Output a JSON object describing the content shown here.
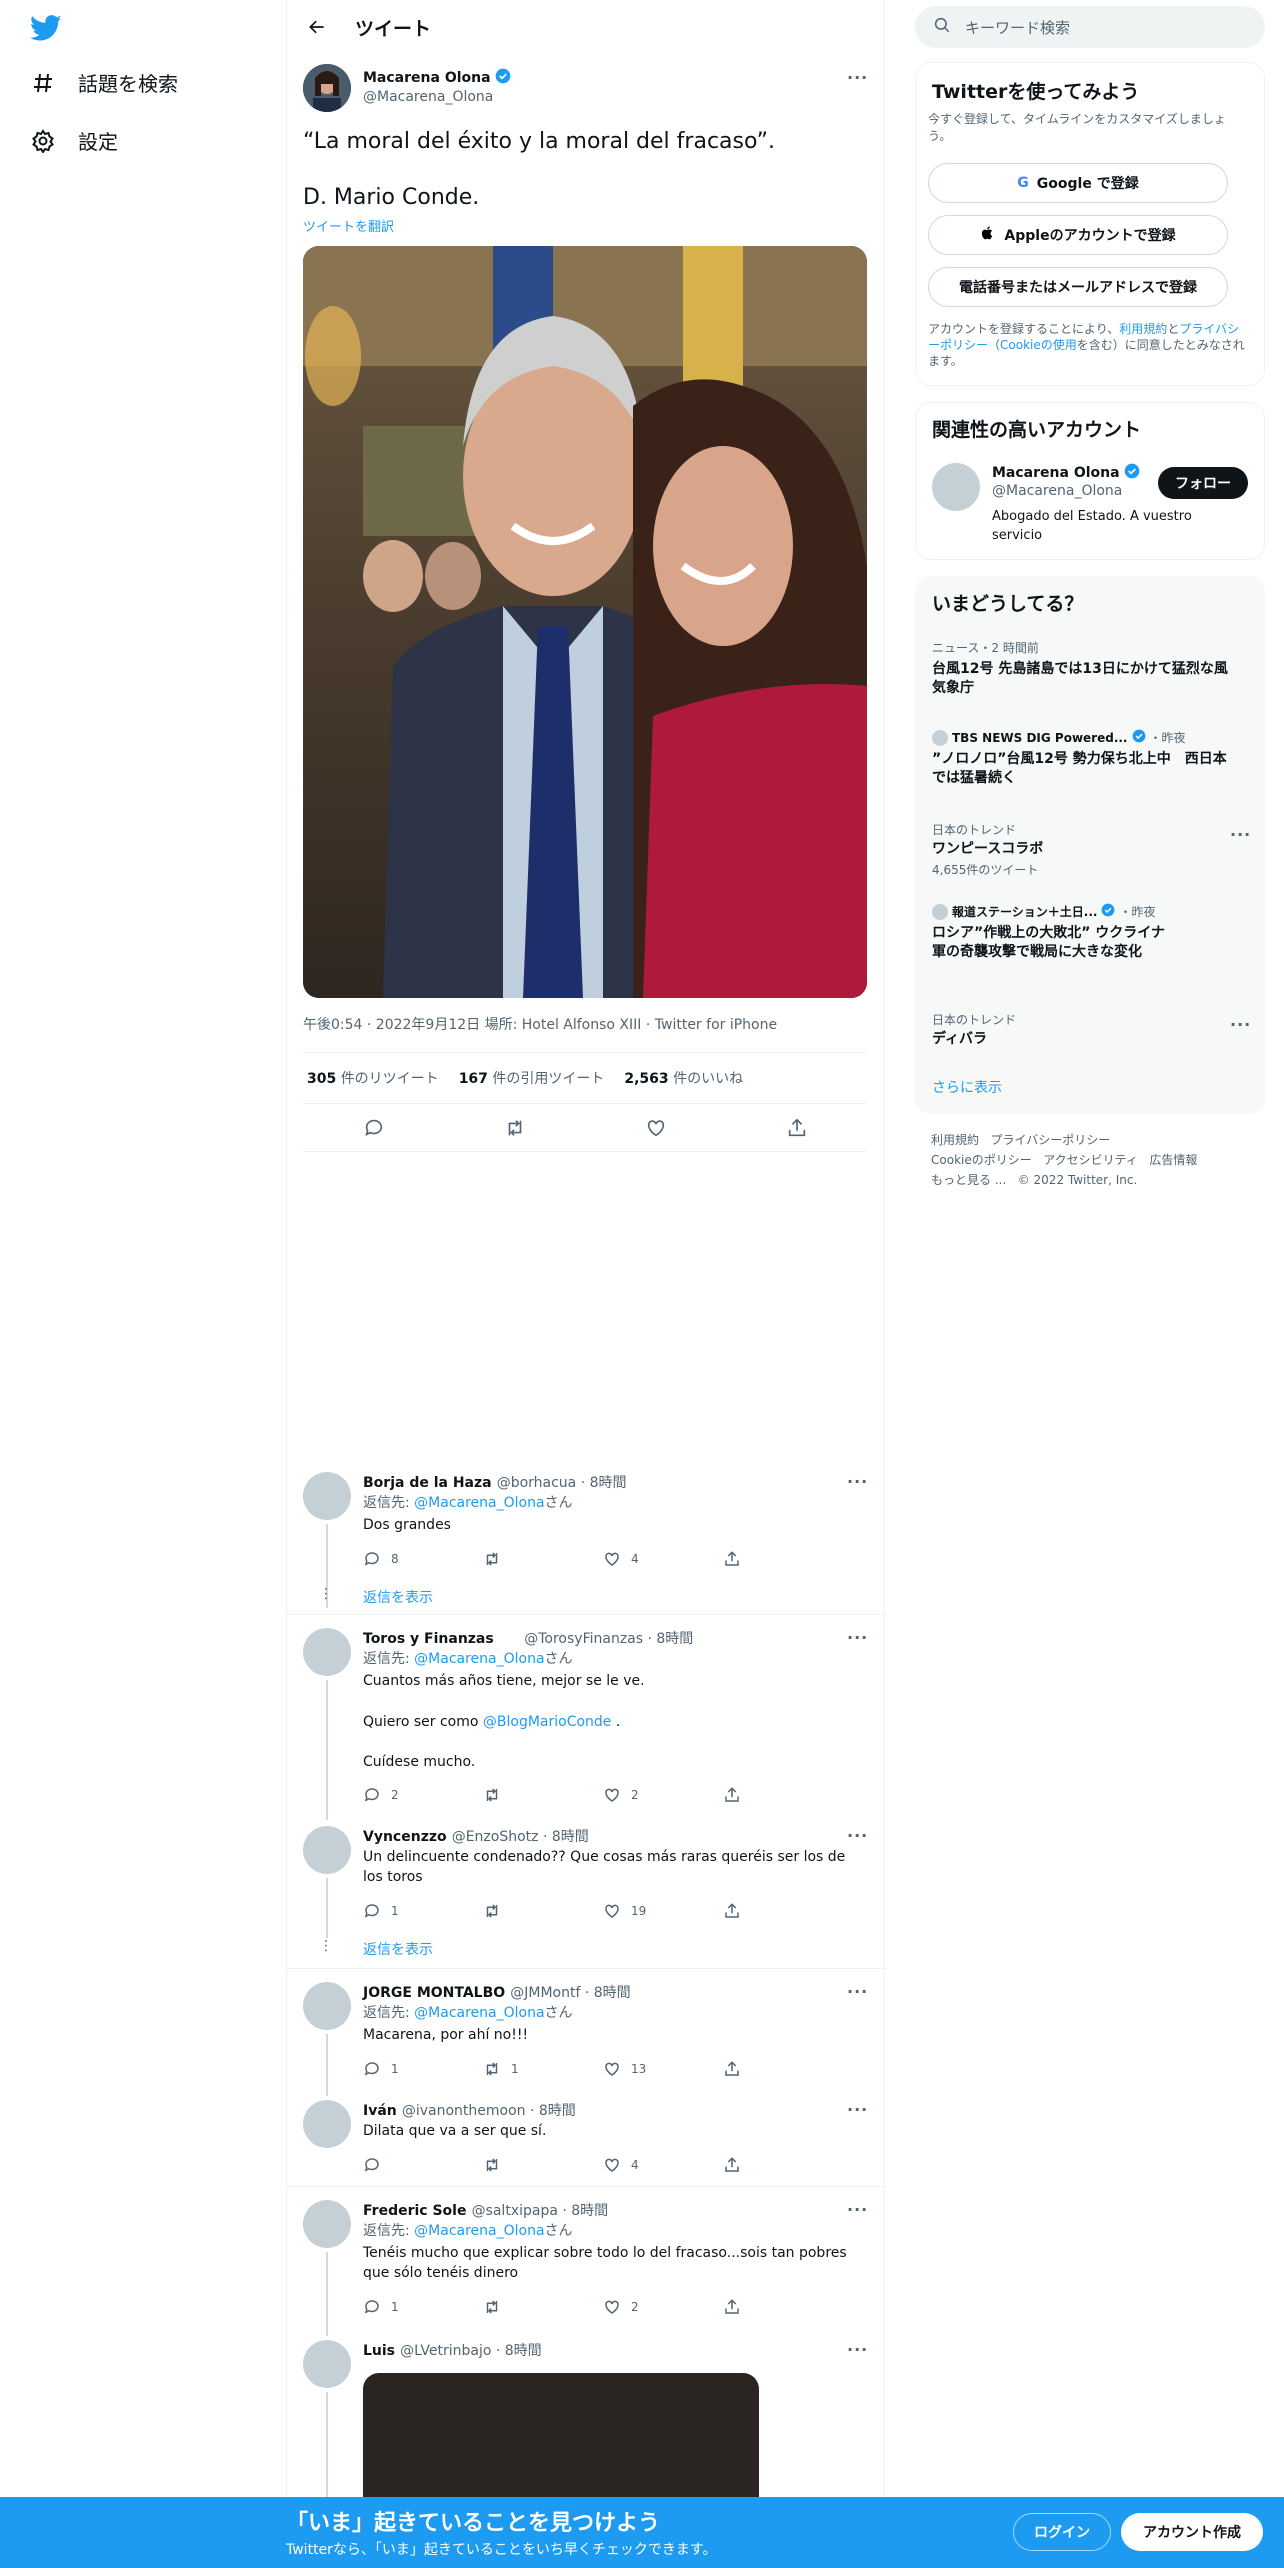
{
  "nav": {
    "explore": "話題を検索",
    "settings": "設定"
  },
  "header": {
    "title": "ツイート"
  },
  "tweet": {
    "name": "Macarena Olona",
    "handle": "@Macarena_Olona",
    "line1": "“La moral del éxito y la moral del fracaso”.",
    "line2": "D. Mario Conde.",
    "translate": "ツイートを翻訳",
    "meta": "午後0:54 · 2022年9月12日 場所: Hotel Alfonso XIII · Twitter for iPhone",
    "retweets_num": "305",
    "retweets_label": "件のリツイート",
    "quotes_num": "167",
    "quotes_label": "件の引用ツイート",
    "likes_num": "2,563",
    "likes_label": "件のいいね"
  },
  "reply_to_prefix": "返信先: ",
  "reply_to_handle": "@Macarena_Olona",
  "reply_to_suffix": "さん",
  "show_replies": "返信を表示",
  "replies": [
    {
      "name": "Borja de la Haza",
      "handle": "@borhacua · 8時間",
      "text": "Dos grandes",
      "replies": "8",
      "rts": "",
      "likes": "4"
    },
    {
      "name": "Toros y Finanzas",
      "handle": "@TorosyFinanzas · 8時間",
      "text1": "Cuantos más años tiene, mejor se le ve.",
      "text2a": "Quiero ser como ",
      "text2b": "@BlogMarioConde",
      "text2c": " .",
      "text3": "Cuídese mucho.",
      "replies": "2",
      "rts": "",
      "likes": "2"
    },
    {
      "name": "Vyncenzzo",
      "handle": "@EnzoShotz · 8時間",
      "text": "Un delincuente condenado?? Que cosas más raras queréis ser los de los toros",
      "replies": "1",
      "rts": "",
      "likes": "19"
    },
    {
      "name": "JORGE MONTALBO",
      "handle": "@JMMontf · 8時間",
      "text": "Macarena, por ahí no!!!",
      "replies": "1",
      "rts": "1",
      "likes": "13"
    },
    {
      "name": "Iván",
      "handle": "@ivanonthemoon · 8時間",
      "text": "Dilata que va a ser que sí.",
      "replies": "",
      "rts": "",
      "likes": "4"
    },
    {
      "name": "Frederic Sole",
      "handle": "@saltxipapa · 8時間",
      "text": "Tenéis mucho que explicar sobre todo lo del fracaso...sois tan pobres que sólo tenéis dinero",
      "replies": "1",
      "rts": "",
      "likes": "2"
    },
    {
      "name": "Luis",
      "handle": "@LVetrinbajo · 8時間"
    }
  ],
  "right": {
    "search_placeholder": "キーワード検索",
    "signup": {
      "title": "Twitterを使ってみよう",
      "subtitle": "今すぐ登録して、タイムラインをカスタマイズしましょう。",
      "google": "Google で登録",
      "apple": "Appleのアカウントで登録",
      "phone": "電話番号またはメールアドレスで登録",
      "terms_a": "アカウントを登録することにより、",
      "terms_b": "利用規約",
      "terms_c": "と",
      "terms_d": "プライバシーポリシー",
      "terms_e": "（",
      "terms_f": "Cookieの使用",
      "terms_g": "を含む）に同意したとみなされます。"
    },
    "related": {
      "title": "関連性の高いアカウント",
      "name": "Macarena Olona",
      "handle": "@Macarena_Olona",
      "bio": "Abogado del Estado. A vuestro servicio",
      "follow": "フォロー"
    },
    "trends": {
      "title": "いまどうしてる？",
      "items": [
        {
          "cat": "ニュース・2 時間前",
          "title": "台風12号 先島諸島では13日にかけて猛烈な風 気象庁"
        },
        {
          "cat": "TBS NEWS DIG Powered...",
          "cat2": "・昨夜",
          "title": "”ノロノロ”台風12号 勢力保ち北上中　西日本では猛暑続く"
        },
        {
          "cat": "日本のトレンド",
          "title": "ワンピースコラボ",
          "sub": "4,655件のツイート"
        },
        {
          "cat": "報道ステーション＋土日...",
          "cat2": "・昨夜",
          "title": "ロシア”作戦上の大敗北” ウクライナ軍の奇襲攻撃で戦局に大きな変化"
        },
        {
          "cat": "日本のトレンド",
          "title": "ディバラ"
        }
      ],
      "more": "さらに表示"
    },
    "footer": {
      "l1a": "利用規約",
      "l1b": "プライバシーポリシー",
      "l2a": "Cookieのポリシー",
      "l2b": "アクセシビリティ",
      "l2c": "広告情報",
      "l3a": "もっと見る ...",
      "l3b": "© 2022 Twitter, Inc."
    }
  },
  "bottom": {
    "title": "「いま」起きていることを見つけよう",
    "subtitle": "Twitterなら、「いま」起きていることをいち早くチェックできます。",
    "login": "ログイン",
    "signup": "アカウント作成"
  }
}
